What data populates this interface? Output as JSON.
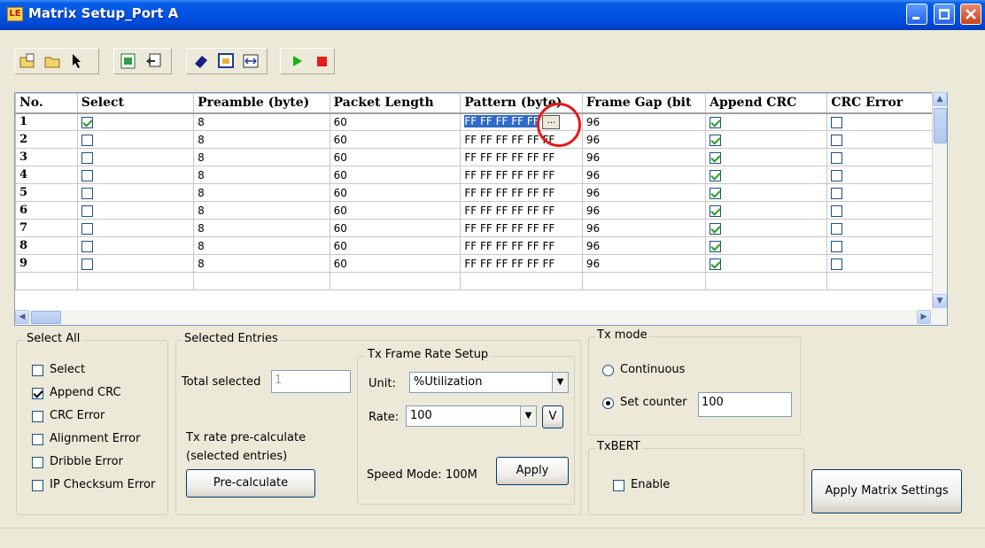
{
  "window": {
    "title": "Matrix Setup_Port A",
    "app_icon_text": "LE",
    "accent_color": "#0054e3"
  },
  "toolbar": {
    "icons": [
      "open-config-icon",
      "open-folder-icon",
      "pointer-icon",
      "export-excel-icon",
      "import-icon",
      "eraser-icon",
      "window-icon",
      "fit-width-icon",
      "play-icon",
      "stop-icon"
    ]
  },
  "grid": {
    "columns": [
      "No.",
      "Select",
      "Preamble (byte)",
      "Packet Length",
      "Pattern (byte)",
      "Frame Gap (bit",
      "Append CRC",
      "CRC Error"
    ],
    "rows": [
      {
        "no": "1",
        "preamble": "8",
        "length": "60",
        "pattern": "FF FF FF FF FF",
        "gap": "96"
      },
      {
        "no": "2",
        "preamble": "8",
        "length": "60",
        "pattern": "FF FF FF FF FF FF",
        "gap": "96"
      },
      {
        "no": "3",
        "preamble": "8",
        "length": "60",
        "pattern": "FF FF FF FF FF FF",
        "gap": "96"
      },
      {
        "no": "4",
        "preamble": "8",
        "length": "60",
        "pattern": "FF FF FF FF FF FF",
        "gap": "96"
      },
      {
        "no": "5",
        "preamble": "8",
        "length": "60",
        "pattern": "FF FF FF FF FF FF",
        "gap": "96"
      },
      {
        "no": "6",
        "preamble": "8",
        "length": "60",
        "pattern": "FF FF FF FF FF FF",
        "gap": "96"
      },
      {
        "no": "7",
        "preamble": "8",
        "length": "60",
        "pattern": "FF FF FF FF FF FF",
        "gap": "96"
      },
      {
        "no": "8",
        "preamble": "8",
        "length": "60",
        "pattern": "FF FF FF FF FF FF",
        "gap": "96"
      },
      {
        "no": "9",
        "preamble": "8",
        "length": "60",
        "pattern": "FF FF FF FF FF FF",
        "gap": "96"
      }
    ],
    "ellipsis_label": "..."
  },
  "select_all": {
    "title": "Select All",
    "options": [
      {
        "label": "Select",
        "checked": false
      },
      {
        "label": "Append CRC",
        "checked": true
      },
      {
        "label": "CRC Error",
        "checked": false
      },
      {
        "label": "Alignment Error",
        "checked": false
      },
      {
        "label": "Dribble Error",
        "checked": false
      },
      {
        "label": "IP Checksum Error",
        "checked": false
      }
    ]
  },
  "selected_entries": {
    "title": "Selected Entries",
    "total_label": "Total selected",
    "total_value": "1",
    "precalc_text_line1": "Tx rate pre-calculate",
    "precalc_text_line2": "(selected entries)",
    "precalc_button": "Pre-calculate"
  },
  "tx_frame_rate": {
    "title": "Tx Frame Rate Setup",
    "unit_label": "Unit:",
    "unit_value": "%Utilization",
    "rate_label": "Rate:",
    "rate_value": "100",
    "v_button": "V",
    "speed_mode": "Speed Mode: 100M",
    "apply_button": "Apply"
  },
  "tx_mode": {
    "title": "Tx mode",
    "continuous_label": "Continuous",
    "set_counter_label": "Set counter",
    "counter_value": "100"
  },
  "txbert": {
    "title": "TxBERT",
    "enable_label": "Enable"
  },
  "apply_matrix_button": "Apply Matrix Settings"
}
